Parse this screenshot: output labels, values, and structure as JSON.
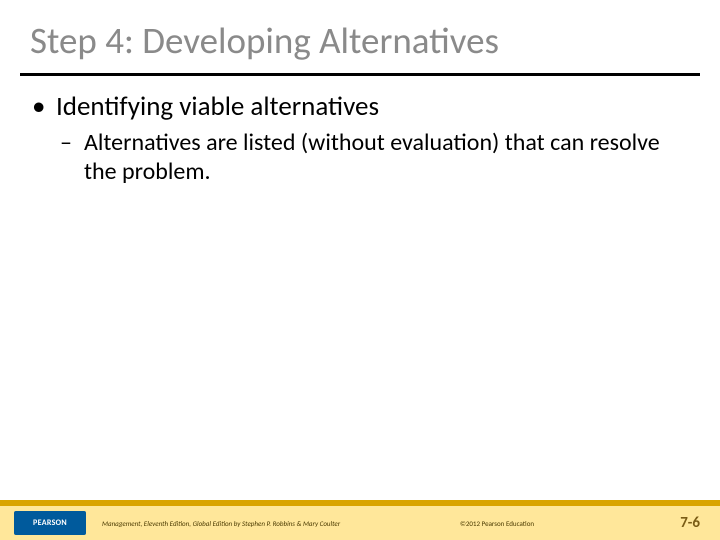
{
  "title": "Step 4: Developing Alternatives",
  "bullets": {
    "level1": "Identifying viable alternatives",
    "level2": "Alternatives are listed (without evaluation) that can resolve the problem."
  },
  "footer": {
    "logo": "PEARSON",
    "credits": "Management, Eleventh Edition, Global Edition by Stephen P. Robbins & Mary Coulter",
    "copyright": "©2012 Pearson Education",
    "page": "7-6"
  }
}
